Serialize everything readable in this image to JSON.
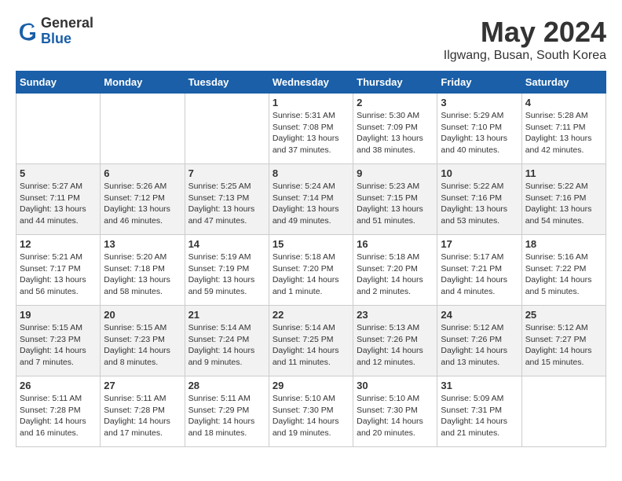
{
  "logo": {
    "general": "General",
    "blue": "Blue"
  },
  "title": "May 2024",
  "subtitle": "Ilgwang, Busan, South Korea",
  "days_header": [
    "Sunday",
    "Monday",
    "Tuesday",
    "Wednesday",
    "Thursday",
    "Friday",
    "Saturday"
  ],
  "weeks": [
    [
      {
        "day": "",
        "text": ""
      },
      {
        "day": "",
        "text": ""
      },
      {
        "day": "",
        "text": ""
      },
      {
        "day": "1",
        "text": "Sunrise: 5:31 AM\nSunset: 7:08 PM\nDaylight: 13 hours and 37 minutes."
      },
      {
        "day": "2",
        "text": "Sunrise: 5:30 AM\nSunset: 7:09 PM\nDaylight: 13 hours and 38 minutes."
      },
      {
        "day": "3",
        "text": "Sunrise: 5:29 AM\nSunset: 7:10 PM\nDaylight: 13 hours and 40 minutes."
      },
      {
        "day": "4",
        "text": "Sunrise: 5:28 AM\nSunset: 7:11 PM\nDaylight: 13 hours and 42 minutes."
      }
    ],
    [
      {
        "day": "5",
        "text": "Sunrise: 5:27 AM\nSunset: 7:11 PM\nDaylight: 13 hours and 44 minutes."
      },
      {
        "day": "6",
        "text": "Sunrise: 5:26 AM\nSunset: 7:12 PM\nDaylight: 13 hours and 46 minutes."
      },
      {
        "day": "7",
        "text": "Sunrise: 5:25 AM\nSunset: 7:13 PM\nDaylight: 13 hours and 47 minutes."
      },
      {
        "day": "8",
        "text": "Sunrise: 5:24 AM\nSunset: 7:14 PM\nDaylight: 13 hours and 49 minutes."
      },
      {
        "day": "9",
        "text": "Sunrise: 5:23 AM\nSunset: 7:15 PM\nDaylight: 13 hours and 51 minutes."
      },
      {
        "day": "10",
        "text": "Sunrise: 5:22 AM\nSunset: 7:16 PM\nDaylight: 13 hours and 53 minutes."
      },
      {
        "day": "11",
        "text": "Sunrise: 5:22 AM\nSunset: 7:16 PM\nDaylight: 13 hours and 54 minutes."
      }
    ],
    [
      {
        "day": "12",
        "text": "Sunrise: 5:21 AM\nSunset: 7:17 PM\nDaylight: 13 hours and 56 minutes."
      },
      {
        "day": "13",
        "text": "Sunrise: 5:20 AM\nSunset: 7:18 PM\nDaylight: 13 hours and 58 minutes."
      },
      {
        "day": "14",
        "text": "Sunrise: 5:19 AM\nSunset: 7:19 PM\nDaylight: 13 hours and 59 minutes."
      },
      {
        "day": "15",
        "text": "Sunrise: 5:18 AM\nSunset: 7:20 PM\nDaylight: 14 hours and 1 minute."
      },
      {
        "day": "16",
        "text": "Sunrise: 5:18 AM\nSunset: 7:20 PM\nDaylight: 14 hours and 2 minutes."
      },
      {
        "day": "17",
        "text": "Sunrise: 5:17 AM\nSunset: 7:21 PM\nDaylight: 14 hours and 4 minutes."
      },
      {
        "day": "18",
        "text": "Sunrise: 5:16 AM\nSunset: 7:22 PM\nDaylight: 14 hours and 5 minutes."
      }
    ],
    [
      {
        "day": "19",
        "text": "Sunrise: 5:15 AM\nSunset: 7:23 PM\nDaylight: 14 hours and 7 minutes."
      },
      {
        "day": "20",
        "text": "Sunrise: 5:15 AM\nSunset: 7:23 PM\nDaylight: 14 hours and 8 minutes."
      },
      {
        "day": "21",
        "text": "Sunrise: 5:14 AM\nSunset: 7:24 PM\nDaylight: 14 hours and 9 minutes."
      },
      {
        "day": "22",
        "text": "Sunrise: 5:14 AM\nSunset: 7:25 PM\nDaylight: 14 hours and 11 minutes."
      },
      {
        "day": "23",
        "text": "Sunrise: 5:13 AM\nSunset: 7:26 PM\nDaylight: 14 hours and 12 minutes."
      },
      {
        "day": "24",
        "text": "Sunrise: 5:12 AM\nSunset: 7:26 PM\nDaylight: 14 hours and 13 minutes."
      },
      {
        "day": "25",
        "text": "Sunrise: 5:12 AM\nSunset: 7:27 PM\nDaylight: 14 hours and 15 minutes."
      }
    ],
    [
      {
        "day": "26",
        "text": "Sunrise: 5:11 AM\nSunset: 7:28 PM\nDaylight: 14 hours and 16 minutes."
      },
      {
        "day": "27",
        "text": "Sunrise: 5:11 AM\nSunset: 7:28 PM\nDaylight: 14 hours and 17 minutes."
      },
      {
        "day": "28",
        "text": "Sunrise: 5:11 AM\nSunset: 7:29 PM\nDaylight: 14 hours and 18 minutes."
      },
      {
        "day": "29",
        "text": "Sunrise: 5:10 AM\nSunset: 7:30 PM\nDaylight: 14 hours and 19 minutes."
      },
      {
        "day": "30",
        "text": "Sunrise: 5:10 AM\nSunset: 7:30 PM\nDaylight: 14 hours and 20 minutes."
      },
      {
        "day": "31",
        "text": "Sunrise: 5:09 AM\nSunset: 7:31 PM\nDaylight: 14 hours and 21 minutes."
      },
      {
        "day": "",
        "text": ""
      }
    ]
  ]
}
